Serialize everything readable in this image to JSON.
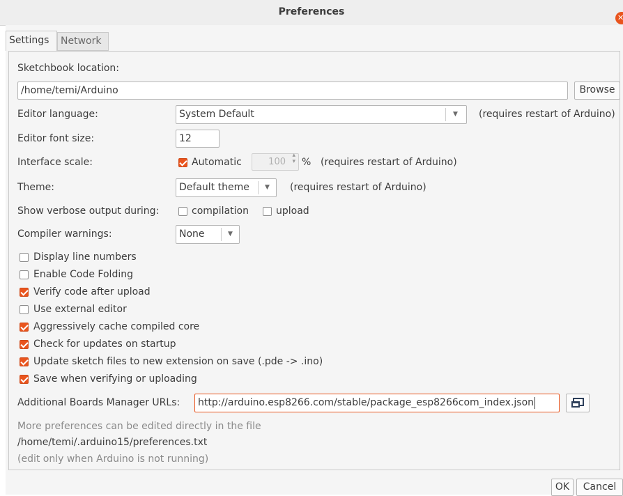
{
  "window": {
    "title": "Preferences"
  },
  "tabs": [
    {
      "label": "Settings"
    },
    {
      "label": "Network"
    }
  ],
  "settings": {
    "sketchbook_label": "Sketchbook location:",
    "sketchbook_path": "/home/temi/Arduino",
    "browse_label": "Browse",
    "editor_language_label": "Editor language:",
    "editor_language_value": "System Default",
    "restart_note": "(requires restart of Arduino)",
    "font_size_label": "Editor font size:",
    "font_size_value": "12",
    "interface_scale_label": "Interface scale:",
    "automatic_label": "Automatic",
    "scale_value": "100",
    "percent": "%",
    "theme_label": "Theme:",
    "theme_value": "Default theme",
    "verbose_label": "Show verbose output during:",
    "compilation_label": "compilation",
    "upload_label": "upload",
    "compiler_warnings_label": "Compiler warnings:",
    "compiler_warnings_value": "None",
    "checkboxes": [
      {
        "label": "Display line numbers",
        "checked": false
      },
      {
        "label": "Enable Code Folding",
        "checked": false
      },
      {
        "label": "Verify code after upload",
        "checked": true
      },
      {
        "label": "Use external editor",
        "checked": false
      },
      {
        "label": "Aggressively cache compiled core",
        "checked": true
      },
      {
        "label": "Check for updates on startup",
        "checked": true
      },
      {
        "label": "Update sketch files to new extension on save (.pde -> .ino)",
        "checked": true
      },
      {
        "label": "Save when verifying or uploading",
        "checked": true
      }
    ],
    "boards_urls_label": "Additional Boards Manager URLs:",
    "boards_urls_value": "http://arduino.esp8266.com/stable/package_esp8266com_index.json",
    "more_prefs": "More preferences can be edited directly in the file",
    "prefs_path": "/home/temi/.arduino15/preferences.txt",
    "edit_note": "(edit only when Arduino is not running)"
  },
  "footer": {
    "ok_label": "OK",
    "cancel_label": "Cancel"
  },
  "colors": {
    "accent": "#e9541d",
    "field_highlight": "#e9541d"
  }
}
